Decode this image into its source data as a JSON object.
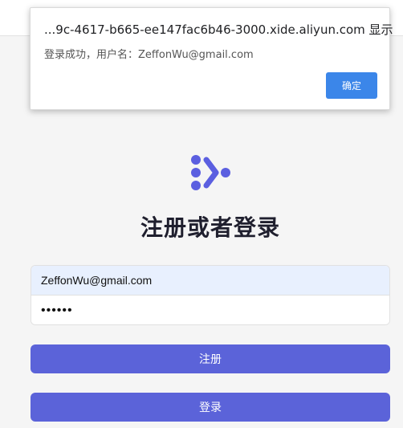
{
  "alert": {
    "title": "...9c-4617-b665-ee147fac6b46-3000.xide.aliyun.com 显示",
    "message": "登录成功，用户名：ZeffonWu@gmail.com",
    "ok_label": "确定"
  },
  "logo": {
    "icon": "dots-chevron-logo",
    "color": "#5b5fe0"
  },
  "auth": {
    "title": "注册或者登录",
    "email_value": "ZeffonWu@gmail.com",
    "password_value": "••••••",
    "register_label": "注册",
    "login_label": "登录"
  },
  "colors": {
    "accent": "#5b63d9",
    "dialog_button": "#3b86e9",
    "autofill_bg": "#e8f0fe"
  }
}
